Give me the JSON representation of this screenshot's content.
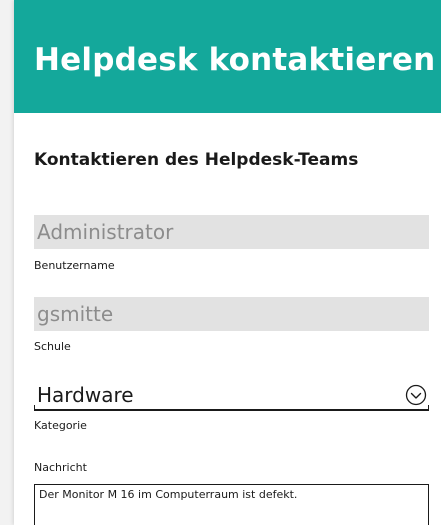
{
  "header": {
    "title": "Helpdesk kontaktieren"
  },
  "form": {
    "title": "Kontaktieren des Helpdesk-Teams",
    "username": {
      "value": "Administrator",
      "label": "Benutzername"
    },
    "school": {
      "value": "gsmitte",
      "label": "Schule"
    },
    "category": {
      "value": "Hardware",
      "label": "Kategorie",
      "icon": "chevron-down-circle-icon"
    },
    "message": {
      "label": "Nachricht",
      "value": "Der Monitor M 16 im Computerraum ist defekt."
    }
  },
  "colors": {
    "accent": "#14a89b",
    "input_background": "#e2e2e2",
    "disabled_text": "#8c8c8c"
  }
}
